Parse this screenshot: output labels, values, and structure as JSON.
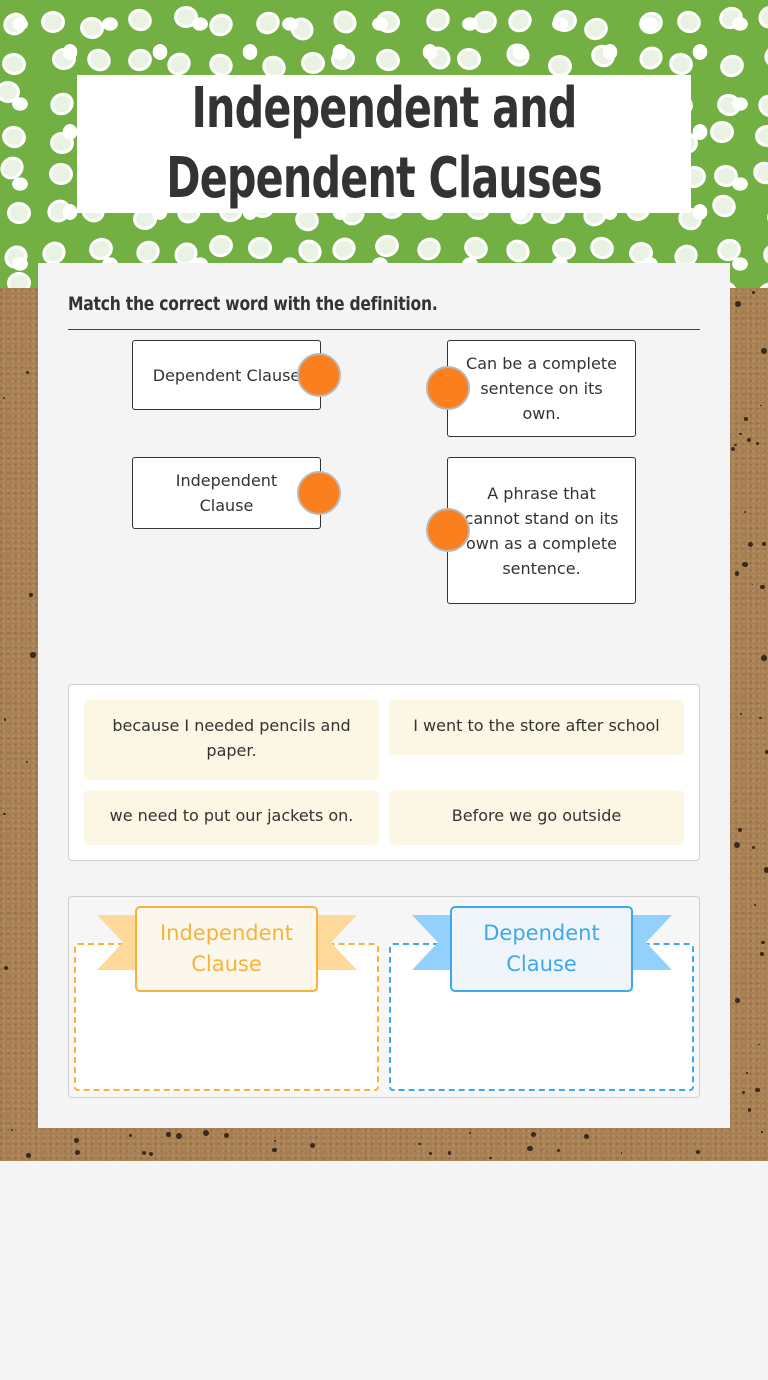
{
  "worksheet": {
    "title": "Independent and Dependent Clauses"
  },
  "matching": {
    "prompt": "Match the correct word with the definition.",
    "terms": [
      {
        "label": "Dependent Clause"
      },
      {
        "label": "Independent Clause"
      }
    ],
    "definitions": [
      {
        "label": "Can be a complete sentence on its own."
      },
      {
        "label": "A phrase that cannot stand on its own as a complete sentence."
      }
    ],
    "connector_color": "#fb7f1c"
  },
  "sorting": {
    "items": [
      {
        "label": "because I needed pencils and paper."
      },
      {
        "label": "I went to the store after school"
      },
      {
        "label": "we need to put our jackets on."
      },
      {
        "label": "Before we go outside"
      }
    ],
    "categories": [
      {
        "label": "Independent Clause",
        "color": "#f8b239",
        "ribbon_color": "#fed99b",
        "fill": "#fcf7ec"
      },
      {
        "label": "Dependent Clause",
        "color": "#3da9ec",
        "ribbon_color": "#93d1fc",
        "fill": "#eff5fa"
      }
    ]
  }
}
